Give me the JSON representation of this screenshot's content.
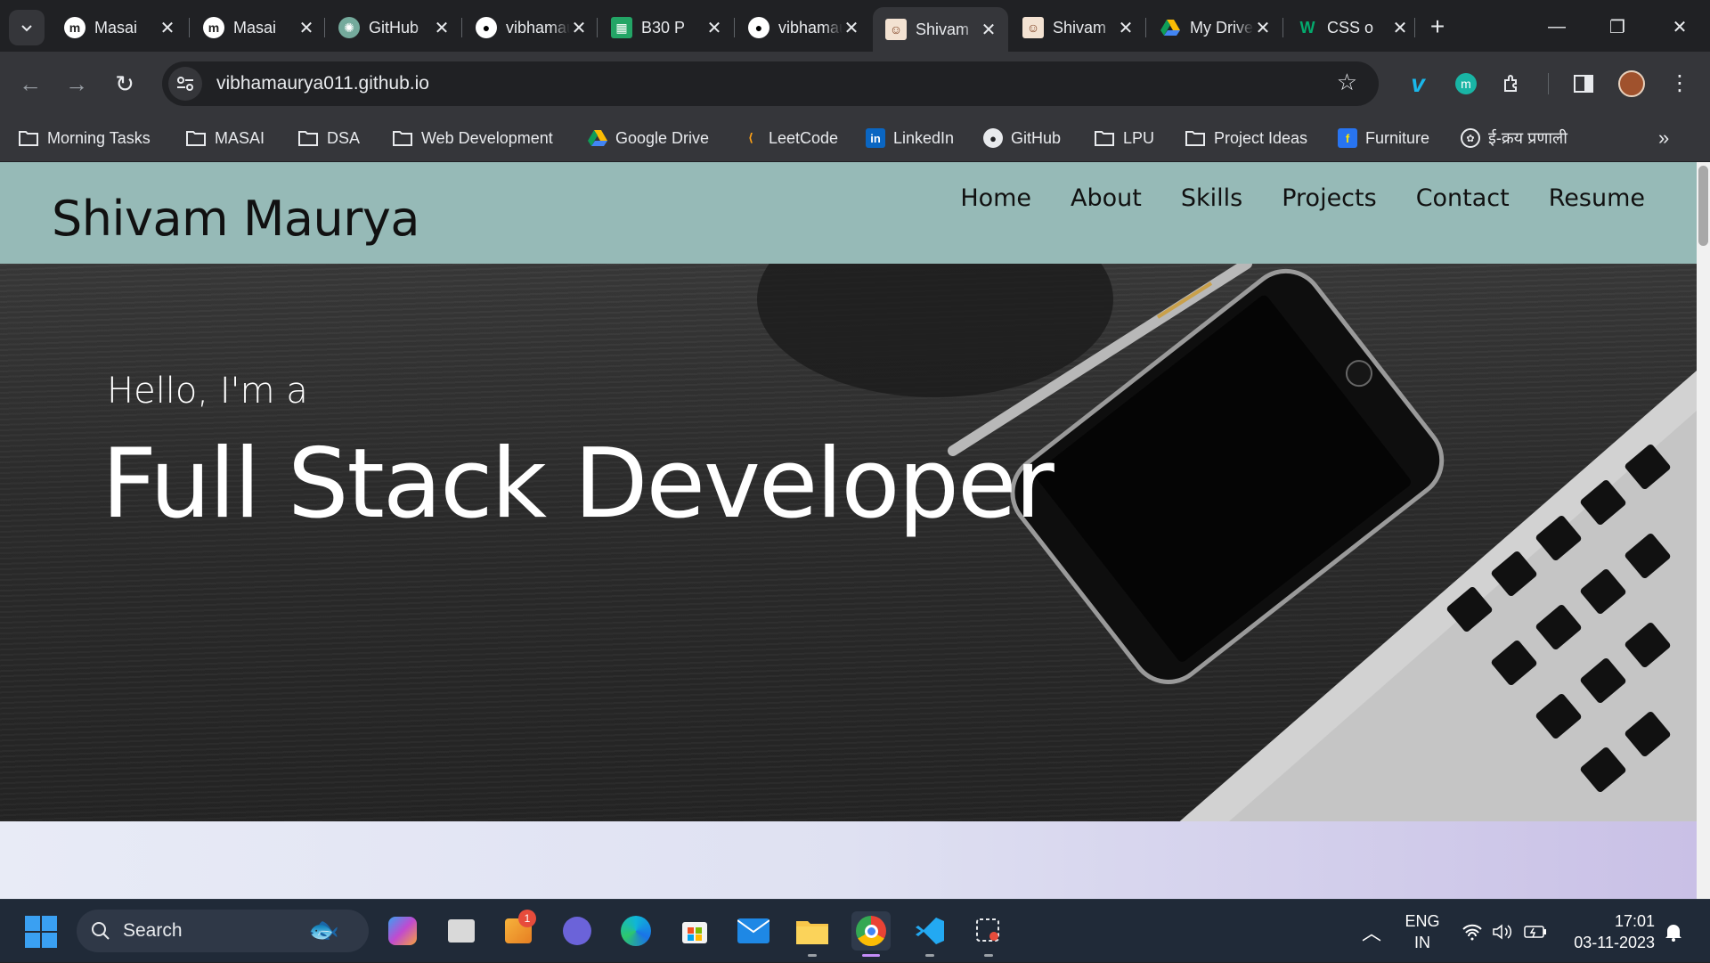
{
  "tabs": [
    {
      "title": "Masai",
      "icon": "masai-icon",
      "active": false
    },
    {
      "title": "Masai",
      "icon": "masai-icon",
      "active": false
    },
    {
      "title": "GitHub",
      "icon": "chatgpt-icon",
      "active": false
    },
    {
      "title": "vibhamaurya",
      "icon": "github-icon",
      "active": false
    },
    {
      "title": "B30 P",
      "icon": "sheets-icon",
      "active": false
    },
    {
      "title": "vibhamaurya",
      "icon": "github-icon",
      "active": false
    },
    {
      "title": "Shivam",
      "icon": "avatar-icon",
      "active": true
    },
    {
      "title": "Shivam",
      "icon": "avatar-icon",
      "active": false
    },
    {
      "title": "My Drive",
      "icon": "drive-icon",
      "active": false
    },
    {
      "title": "CSS o",
      "icon": "w3schools-icon",
      "active": false
    }
  ],
  "toolbar": {
    "url": "vibhamaurya011.github.io"
  },
  "bookmarks": [
    {
      "label": "Morning Tasks",
      "icon": "folder-icon"
    },
    {
      "label": "MASAI",
      "icon": "folder-icon"
    },
    {
      "label": "DSA",
      "icon": "folder-icon"
    },
    {
      "label": "Web Development",
      "icon": "folder-icon"
    },
    {
      "label": "Google Drive",
      "icon": "drive-icon"
    },
    {
      "label": "LeetCode",
      "icon": "leetcode-icon"
    },
    {
      "label": "LinkedIn",
      "icon": "linkedin-icon"
    },
    {
      "label": "GitHub",
      "icon": "github-icon"
    },
    {
      "label": "LPU",
      "icon": "folder-icon"
    },
    {
      "label": "Project Ideas",
      "icon": "folder-icon"
    },
    {
      "label": "Furniture",
      "icon": "flipkart-icon"
    },
    {
      "label": "ई-क्रय प्रणाली",
      "icon": "emblem-icon"
    }
  ],
  "site": {
    "logo": "Shivam Maurya",
    "menu": [
      "Home",
      "About",
      "Skills",
      "Projects",
      "Contact",
      "Resume"
    ],
    "hero_sub": "Hello, I'm a",
    "hero_title": "Full Stack Developer"
  },
  "taskbar": {
    "search_placeholder": "Search",
    "lang_top": "ENG",
    "lang_bottom": "IN",
    "time": "17:01",
    "date": "03-11-2023",
    "notification_badge": "1"
  },
  "colors": {
    "nav_bg": "#96bab7",
    "chrome_dark": "#202124",
    "chrome_toolbar": "#35363a",
    "taskbar": "#202a38"
  }
}
